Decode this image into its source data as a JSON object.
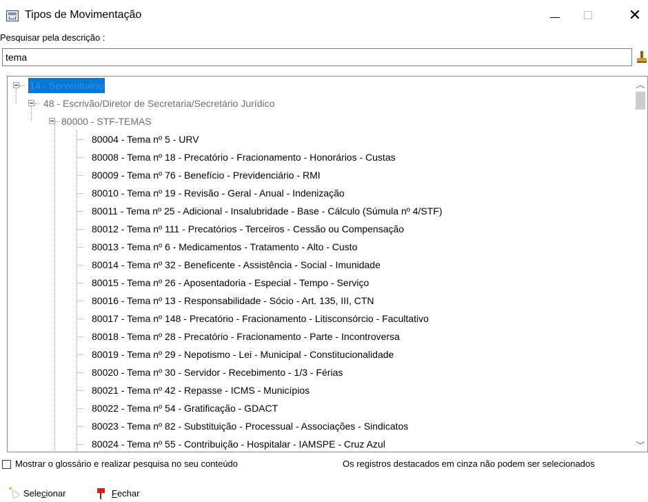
{
  "window": {
    "title": "Tipos de Movimentação"
  },
  "search": {
    "label": "Pesquisar pela descrição :",
    "value": "tema"
  },
  "tree": {
    "root": {
      "label": "14 - Serventuário",
      "state": "selected"
    },
    "level1": {
      "label": "48 - Escrivão/Diretor de Secretaria/Secretário Jurídico",
      "state": "grey"
    },
    "level2": {
      "label": "80000 - STF-TEMAS",
      "state": "grey"
    },
    "items": [
      "80004 - Tema nº 5 - URV",
      "80008 - Tema nº 18 - Precatório - Fracionamento - Honorários - Custas",
      "80009 - Tema nº 76 - Benefício - Previdenciário - RMI",
      "80010 - Tema nº 19 - Revisão - Geral - Anual - Indenização",
      "80011 - Tema nº 25 - Adicional - Insalubridade - Base - Cálculo (Súmula nº 4/STF)",
      "80012 - Tema nº 111 - Precatórios - Terceiros - Cessão ou Compensação",
      "80013 - Tema nº 6 - Medicamentos - Tratamento - Alto - Custo",
      "80014 - Tema nº 32 - Beneficente - Assistência - Social - Imunidade",
      "80015 - Tema nº 26 - Aposentadoria - Especial - Tempo - Serviço",
      "80016 - Tema nº 13 - Responsabilidade - Sócio - Art. 135, III, CTN",
      "80017 - Tema nº 148 - Precatório - Fracionamento - Litisconsórcio - Facultativo",
      "80018 - Tema nº 28 - Precatório - Fracionamento - Parte - Incontroversa",
      "80019 - Tema nº 29 - Nepotismo - Lei - Municipal - Constitucionalidade",
      "80020 - Tema nº 30 - Servidor - Recebimento - 1/3 - Férias",
      "80021 - Tema nº 42 - Repasse - ICMS - Municípios",
      "80022 - Tema nº 54 - Gratificação - GDACT",
      "80023 - Tema nº 82 - Substituição - Processual - Associações - Sindicatos",
      "80024 - Tema nº 55 - Contribuição - Hospitalar - IAMSPE - Cruz Azul"
    ]
  },
  "footer": {
    "glossary_label": "Mostrar o glossário e realizar pesquisa no seu conteúdo",
    "glossary_checked": false,
    "info_text": "Os registros destacados em cinza não podem ser selecionados",
    "select_pre": "Sele",
    "select_ul": "c",
    "select_post": "ionar",
    "close_ul": "F",
    "close_post": "echar"
  },
  "colors": {
    "selection": "#0078d7",
    "grey_text": "#6d6d6d"
  }
}
